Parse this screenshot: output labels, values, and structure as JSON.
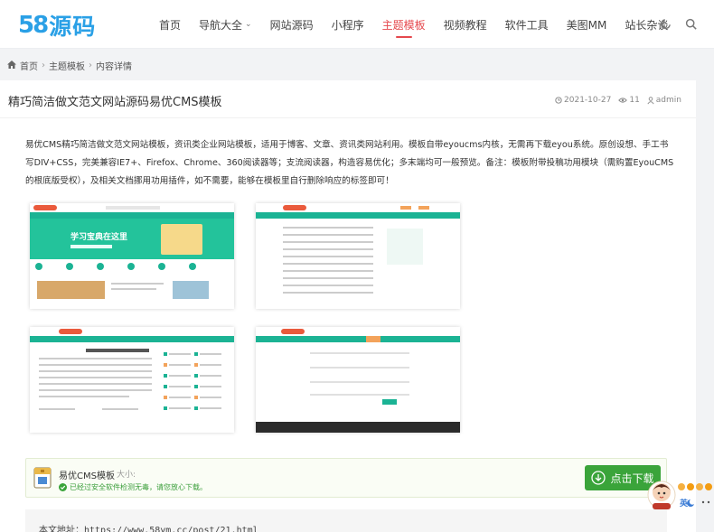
{
  "header": {
    "logo_num": "58",
    "logo_text": "源码",
    "nav": [
      "首页",
      "导航大全",
      "网站源码",
      "小程序",
      "主题模板",
      "视频教程",
      "软件工具",
      "美图MM",
      "站长杂谈"
    ],
    "active_index": 4,
    "dropdown_index": 1
  },
  "breadcrumb": {
    "home": "首页",
    "cat": "主题模板",
    "current": "内容详情"
  },
  "post": {
    "title": "精巧简洁做文范文网站源码易优CMS模板",
    "date": "2021-10-27",
    "views": "11",
    "author": "admin",
    "body": "易优CMS精巧简洁做文范文网站模板，资讯类企业网站模板，适用于博客、文章、资讯类网站利用。模板自带eyoucms内核，无需再下载eyou系统。原创设想、手工书写DIV+CSS，完美兼容IE7+、Firefox、Chrome、360阅读器等；支流阅读器，构造容易优化；多末端均可一般预览。备注：模板附带投稿功用模块（需购置EyouCMS的根底版受权），及相关文档挪用功用插件，如不需要，能够在模板里自行删除响应的标签即可！",
    "banner_text": "学习宝典在这里"
  },
  "download": {
    "name": "易优CMS模板",
    "size_label": "大小:",
    "safe_text": "已经过安全软件检测无毒，请您放心下载。",
    "button": "点击下载"
  },
  "url_label": "本文地址：https://www.58ym.cc/post/21.html",
  "widget": {
    "label": "英"
  },
  "colors": {
    "accent": "#e5484d",
    "brand": "#2aa0e6",
    "green": "#3aa43a",
    "teal": "#1bb394"
  }
}
